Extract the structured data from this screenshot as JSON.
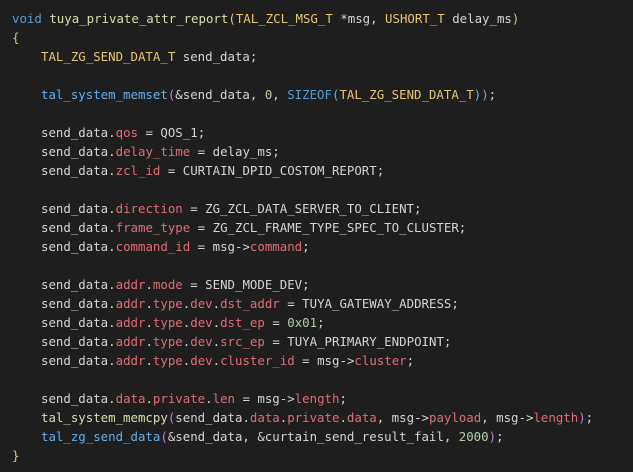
{
  "colors": {
    "background": "#1e1e1e",
    "keyword": "#569cd6",
    "function": "#dcdcaa",
    "type": "#e8c66b",
    "macro": "#d3997a",
    "member": "#e06c75",
    "number": "#b5cea8",
    "text": "#d4d4d4"
  },
  "code": {
    "lines": [
      [
        {
          "t": "void",
          "c": "kw"
        },
        {
          "t": " ",
          "c": "op"
        },
        {
          "t": "tuya_private_attr_report",
          "c": "fn"
        },
        {
          "t": "(",
          "c": "brace"
        },
        {
          "t": "TAL_ZCL_MSG_T",
          "c": "type"
        },
        {
          "t": " *",
          "c": "op"
        },
        {
          "t": "msg",
          "c": "var"
        },
        {
          "t": ", ",
          "c": "op"
        },
        {
          "t": "USHORT_T",
          "c": "type"
        },
        {
          "t": " ",
          "c": "op"
        },
        {
          "t": "delay_ms",
          "c": "var"
        },
        {
          "t": ")",
          "c": "brace"
        }
      ],
      [
        {
          "t": "{",
          "c": "brace"
        }
      ],
      [
        {
          "indent": 1
        },
        {
          "t": "TAL_ZG_SEND_DATA_T",
          "c": "type"
        },
        {
          "t": " send_data;",
          "c": "var"
        }
      ],
      [],
      [
        {
          "indent": 1
        },
        {
          "t": "tal_system_memset",
          "c": "func-call"
        },
        {
          "t": "(",
          "c": "paren"
        },
        {
          "t": "&send_data, ",
          "c": "var"
        },
        {
          "t": "0",
          "c": "num"
        },
        {
          "t": ", ",
          "c": "op"
        },
        {
          "t": "SIZEOF",
          "c": "kw"
        },
        {
          "t": "(",
          "c": "func-call"
        },
        {
          "t": "TAL_ZG_SEND_DATA_T",
          "c": "type"
        },
        {
          "t": ")",
          "c": "func-call"
        },
        {
          "t": ")",
          "c": "paren"
        },
        {
          "t": ";",
          "c": "op"
        }
      ],
      [],
      [
        {
          "indent": 1
        },
        {
          "t": "send_data",
          "c": "var"
        },
        {
          "t": ".",
          "c": "op"
        },
        {
          "t": "qos",
          "c": "member"
        },
        {
          "t": " = ",
          "c": "op"
        },
        {
          "t": "QOS_1",
          "c": "var"
        },
        {
          "t": ";",
          "c": "op"
        }
      ],
      [
        {
          "indent": 1
        },
        {
          "t": "send_data",
          "c": "var"
        },
        {
          "t": ".",
          "c": "op"
        },
        {
          "t": "delay_time",
          "c": "member"
        },
        {
          "t": " = ",
          "c": "op"
        },
        {
          "t": "delay_ms",
          "c": "var"
        },
        {
          "t": ";",
          "c": "op"
        }
      ],
      [
        {
          "indent": 1
        },
        {
          "t": "send_data",
          "c": "var"
        },
        {
          "t": ".",
          "c": "op"
        },
        {
          "t": "zcl_id",
          "c": "member"
        },
        {
          "t": " = ",
          "c": "op"
        },
        {
          "t": "CURTAIN_DPID_COSTOM_REPORT",
          "c": "var"
        },
        {
          "t": ";",
          "c": "op"
        }
      ],
      [],
      [
        {
          "indent": 1
        },
        {
          "t": "send_data",
          "c": "var"
        },
        {
          "t": ".",
          "c": "op"
        },
        {
          "t": "direction",
          "c": "member"
        },
        {
          "t": " = ",
          "c": "op"
        },
        {
          "t": "ZG_ZCL_DATA_SERVER_TO_CLIENT",
          "c": "var"
        },
        {
          "t": ";",
          "c": "op"
        }
      ],
      [
        {
          "indent": 1
        },
        {
          "t": "send_data",
          "c": "var"
        },
        {
          "t": ".",
          "c": "op"
        },
        {
          "t": "frame_type",
          "c": "member"
        },
        {
          "t": " = ",
          "c": "op"
        },
        {
          "t": "ZG_ZCL_FRAME_TYPE_SPEC_TO_CLUSTER",
          "c": "var"
        },
        {
          "t": ";",
          "c": "op"
        }
      ],
      [
        {
          "indent": 1
        },
        {
          "t": "send_data",
          "c": "var"
        },
        {
          "t": ".",
          "c": "op"
        },
        {
          "t": "command_id",
          "c": "member"
        },
        {
          "t": " = ",
          "c": "op"
        },
        {
          "t": "msg",
          "c": "var"
        },
        {
          "t": "->",
          "c": "op"
        },
        {
          "t": "command",
          "c": "member"
        },
        {
          "t": ";",
          "c": "op"
        }
      ],
      [],
      [
        {
          "indent": 1
        },
        {
          "t": "send_data",
          "c": "var"
        },
        {
          "t": ".",
          "c": "op"
        },
        {
          "t": "addr",
          "c": "member"
        },
        {
          "t": ".",
          "c": "op"
        },
        {
          "t": "mode",
          "c": "member"
        },
        {
          "t": " = ",
          "c": "op"
        },
        {
          "t": "SEND_MODE_DEV",
          "c": "var"
        },
        {
          "t": ";",
          "c": "op"
        }
      ],
      [
        {
          "indent": 1
        },
        {
          "t": "send_data",
          "c": "var"
        },
        {
          "t": ".",
          "c": "op"
        },
        {
          "t": "addr",
          "c": "member"
        },
        {
          "t": ".",
          "c": "op"
        },
        {
          "t": "type",
          "c": "member"
        },
        {
          "t": ".",
          "c": "op"
        },
        {
          "t": "dev",
          "c": "member"
        },
        {
          "t": ".",
          "c": "op"
        },
        {
          "t": "dst_addr",
          "c": "member"
        },
        {
          "t": " = ",
          "c": "op"
        },
        {
          "t": "TUYA_GATEWAY_ADDRESS",
          "c": "var"
        },
        {
          "t": ";",
          "c": "op"
        }
      ],
      [
        {
          "indent": 1
        },
        {
          "t": "send_data",
          "c": "var"
        },
        {
          "t": ".",
          "c": "op"
        },
        {
          "t": "addr",
          "c": "member"
        },
        {
          "t": ".",
          "c": "op"
        },
        {
          "t": "type",
          "c": "member"
        },
        {
          "t": ".",
          "c": "op"
        },
        {
          "t": "dev",
          "c": "member"
        },
        {
          "t": ".",
          "c": "op"
        },
        {
          "t": "dst_ep",
          "c": "member"
        },
        {
          "t": " = ",
          "c": "op"
        },
        {
          "t": "0x01",
          "c": "num"
        },
        {
          "t": ";",
          "c": "op"
        }
      ],
      [
        {
          "indent": 1
        },
        {
          "t": "send_data",
          "c": "var"
        },
        {
          "t": ".",
          "c": "op"
        },
        {
          "t": "addr",
          "c": "member"
        },
        {
          "t": ".",
          "c": "op"
        },
        {
          "t": "type",
          "c": "member"
        },
        {
          "t": ".",
          "c": "op"
        },
        {
          "t": "dev",
          "c": "member"
        },
        {
          "t": ".",
          "c": "op"
        },
        {
          "t": "src_ep",
          "c": "member"
        },
        {
          "t": " = ",
          "c": "op"
        },
        {
          "t": "TUYA_PRIMARY_ENDPOINT",
          "c": "var"
        },
        {
          "t": ";",
          "c": "op"
        }
      ],
      [
        {
          "indent": 1
        },
        {
          "t": "send_data",
          "c": "var"
        },
        {
          "t": ".",
          "c": "op"
        },
        {
          "t": "addr",
          "c": "member"
        },
        {
          "t": ".",
          "c": "op"
        },
        {
          "t": "type",
          "c": "member"
        },
        {
          "t": ".",
          "c": "op"
        },
        {
          "t": "dev",
          "c": "member"
        },
        {
          "t": ".",
          "c": "op"
        },
        {
          "t": "cluster_id",
          "c": "member"
        },
        {
          "t": " = ",
          "c": "op"
        },
        {
          "t": "msg",
          "c": "var"
        },
        {
          "t": "->",
          "c": "op"
        },
        {
          "t": "cluster",
          "c": "member"
        },
        {
          "t": ";",
          "c": "op"
        }
      ],
      [],
      [
        {
          "indent": 1
        },
        {
          "t": "send_data",
          "c": "var"
        },
        {
          "t": ".",
          "c": "op"
        },
        {
          "t": "data",
          "c": "member"
        },
        {
          "t": ".",
          "c": "op"
        },
        {
          "t": "private",
          "c": "member"
        },
        {
          "t": ".",
          "c": "op"
        },
        {
          "t": "len",
          "c": "member"
        },
        {
          "t": " = ",
          "c": "op"
        },
        {
          "t": "msg",
          "c": "var"
        },
        {
          "t": "->",
          "c": "op"
        },
        {
          "t": "length",
          "c": "member"
        },
        {
          "t": ";",
          "c": "op"
        }
      ],
      [
        {
          "indent": 1
        },
        {
          "t": "tal_system_memcpy",
          "c": "fn"
        },
        {
          "t": "(",
          "c": "paren"
        },
        {
          "t": "send_data",
          "c": "var"
        },
        {
          "t": ".",
          "c": "op"
        },
        {
          "t": "data",
          "c": "member"
        },
        {
          "t": ".",
          "c": "op"
        },
        {
          "t": "private",
          "c": "member"
        },
        {
          "t": ".",
          "c": "op"
        },
        {
          "t": "data",
          "c": "member"
        },
        {
          "t": ", ",
          "c": "op"
        },
        {
          "t": "msg",
          "c": "var"
        },
        {
          "t": "->",
          "c": "op"
        },
        {
          "t": "payload",
          "c": "member"
        },
        {
          "t": ", ",
          "c": "op"
        },
        {
          "t": "msg",
          "c": "var"
        },
        {
          "t": "->",
          "c": "op"
        },
        {
          "t": "length",
          "c": "member"
        },
        {
          "t": ")",
          "c": "paren"
        },
        {
          "t": ";",
          "c": "op"
        }
      ],
      [
        {
          "indent": 1
        },
        {
          "t": "tal_zg_send_data",
          "c": "func-call"
        },
        {
          "t": "(",
          "c": "paren"
        },
        {
          "t": "&send_data, &curtain_send_result_fail, ",
          "c": "var"
        },
        {
          "t": "2000",
          "c": "num"
        },
        {
          "t": ")",
          "c": "paren"
        },
        {
          "t": ";",
          "c": "op"
        }
      ],
      [
        {
          "t": "}",
          "c": "brace"
        }
      ]
    ]
  }
}
